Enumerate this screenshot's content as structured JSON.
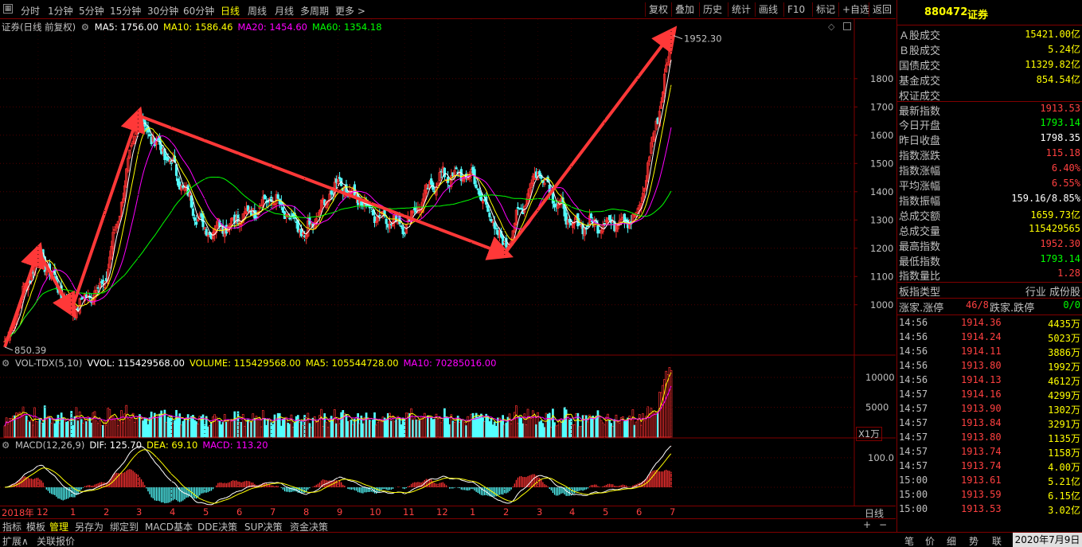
{
  "toolbar": {
    "periods": [
      "分时",
      "1分钟",
      "5分钟",
      "15分钟",
      "30分钟",
      "60分钟",
      "日线",
      "周线",
      "月线",
      "多周期",
      "更多 >"
    ],
    "active_period": "日线",
    "buttons": [
      "复权",
      "叠加",
      "历史",
      "统计",
      "画线",
      "F10",
      "标记",
      "+自选",
      "返回"
    ]
  },
  "main_chart": {
    "title": "证券(日线 前复权)",
    "ma_labels": [
      {
        "text": "MA5: 1756.00",
        "color": "#ffffff"
      },
      {
        "text": "MA10: 1586.46",
        "color": "#ffff00"
      },
      {
        "text": "MA20: 1454.60",
        "color": "#ff00ff"
      },
      {
        "text": "MA60: 1354.18",
        "color": "#00ff00"
      }
    ],
    "high_marker": "1952.30",
    "low_marker": "850.39",
    "y_ticks": [
      "1800",
      "1700",
      "1600",
      "1500",
      "1400",
      "1300",
      "1200",
      "1100",
      "1000"
    ]
  },
  "volume_chart": {
    "labels": [
      {
        "text": "VOL-TDX(5,10)",
        "color": "#c0c0c0"
      },
      {
        "text": "VVOL: 115429568.00",
        "color": "#ffffff"
      },
      {
        "text": "VOLUME: 115429568.00",
        "color": "#ffff00"
      },
      {
        "text": "MA5: 105544728.00",
        "color": "#ffff00"
      },
      {
        "text": "MA10: 70285016.00",
        "color": "#ff00ff"
      }
    ],
    "y_ticks": [
      "10000",
      "5000"
    ],
    "unit": "X1万"
  },
  "macd_chart": {
    "labels": [
      {
        "text": "MACD(12,26,9)",
        "color": "#c0c0c0"
      },
      {
        "text": "DIF: 125.70",
        "color": "#ffffff"
      },
      {
        "text": "DEA: 69.10",
        "color": "#ffff00"
      },
      {
        "text": "MACD: 113.20",
        "color": "#ff00ff"
      }
    ],
    "y_ticks": [
      "100.0"
    ]
  },
  "x_axis": {
    "labels": [
      "2018年",
      "12",
      "1",
      "2",
      "3",
      "4",
      "5",
      "6",
      "7",
      "8",
      "9",
      "10",
      "11",
      "12",
      "1",
      "2",
      "3",
      "4",
      "5",
      "6",
      "7"
    ],
    "period_label": "日线"
  },
  "bottom_tabs": [
    "指标",
    "模板",
    "管理",
    "另存为",
    "绑定到",
    "MACD基本",
    "DDE决策",
    "SUP决策",
    "资金决策"
  ],
  "active_bottom_tab": "管理",
  "status_bar": {
    "left": [
      "扩展∧",
      "关联报价"
    ],
    "right_tabs": [
      "笔",
      "价",
      "细",
      "势",
      "联"
    ],
    "date": "2020年7月9日"
  },
  "quote_panel": {
    "code": "880472",
    "name": "证券",
    "rows": [
      {
        "label": "Ａ股成交",
        "value": "15421.00亿",
        "color": "#ffff00"
      },
      {
        "label": "Ｂ股成交",
        "value": "5.24亿",
        "color": "#ffff00"
      },
      {
        "label": "国债成交",
        "value": "11329.82亿",
        "color": "#ffff00"
      },
      {
        "label": "基金成交",
        "value": "854.54亿",
        "color": "#ffff00"
      },
      {
        "label": "权证成交",
        "value": "",
        "color": "#ffff00"
      },
      {
        "label": "最新指数",
        "value": "1913.53",
        "color": "#ff4040"
      },
      {
        "label": "今日开盘",
        "value": "1793.14",
        "color": "#00ff00"
      },
      {
        "label": "昨日收盘",
        "value": "1798.35",
        "color": "#ffffff"
      },
      {
        "label": "指数涨跌",
        "value": "115.18",
        "color": "#ff4040"
      },
      {
        "label": "指数涨幅",
        "value": "6.40%",
        "color": "#ff4040"
      },
      {
        "label": "平均涨幅",
        "value": "6.55%",
        "color": "#ff4040"
      },
      {
        "label": "指数振幅",
        "value": "159.16/8.85%",
        "color": "#ffffff"
      },
      {
        "label": "总成交额",
        "value": "1659.73亿",
        "color": "#ffff00"
      },
      {
        "label": "总成交量",
        "value": "115429565",
        "color": "#ffff00"
      },
      {
        "label": "最高指数",
        "value": "1952.30",
        "color": "#ff4040"
      },
      {
        "label": "最低指数",
        "value": "1793.14",
        "color": "#00ff00"
      },
      {
        "label": "指数量比",
        "value": "1.28",
        "color": "#ff4040"
      }
    ],
    "type_row": {
      "label": "板指类型",
      "value": "行业 成份股"
    },
    "updown_row": {
      "up_label": "涨家.涨停",
      "up_value": "46/8",
      "down_label": "跌家.跌停",
      "down_value": "0/0"
    },
    "ticks": [
      {
        "time": "14:56",
        "price": "1914.36",
        "vol": "4435万"
      },
      {
        "time": "14:56",
        "price": "1914.24",
        "vol": "5023万"
      },
      {
        "time": "14:56",
        "price": "1914.11",
        "vol": "3886万"
      },
      {
        "time": "14:56",
        "price": "1913.80",
        "vol": "1992万"
      },
      {
        "time": "14:56",
        "price": "1914.13",
        "vol": "4612万"
      },
      {
        "time": "14:57",
        "price": "1914.16",
        "vol": "4299万"
      },
      {
        "time": "14:57",
        "price": "1913.90",
        "vol": "1302万"
      },
      {
        "time": "14:57",
        "price": "1913.84",
        "vol": "3291万"
      },
      {
        "time": "14:57",
        "price": "1913.80",
        "vol": "1135万"
      },
      {
        "time": "14:57",
        "price": "1913.74",
        "vol": "1158万"
      },
      {
        "time": "14:57",
        "price": "1913.74",
        "vol": "4.00万"
      },
      {
        "time": "15:00",
        "price": "1913.61",
        "vol": "5.21亿"
      },
      {
        "time": "15:00",
        "price": "1913.59",
        "vol": "6.15亿"
      },
      {
        "time": "15:00",
        "price": "1913.53",
        "vol": "3.02亿"
      }
    ]
  },
  "chart_data": {
    "type": "candlestick",
    "x_labels": [
      "2018年",
      "12",
      "1",
      "2",
      "3",
      "4",
      "5",
      "6",
      "7",
      "8",
      "9",
      "10",
      "11",
      "12",
      "1",
      "2",
      "3",
      "4",
      "5",
      "6",
      "7"
    ],
    "ylim": [
      850,
      1960
    ],
    "waypoints": [
      {
        "month": "2018-11",
        "close": 850
      },
      {
        "month": "2018-12",
        "close": 1190
      },
      {
        "month": "2019-01",
        "close": 980
      },
      {
        "month": "2019-02",
        "close": 1080
      },
      {
        "month": "2019-03",
        "close": 1660
      },
      {
        "month": "2019-04",
        "close": 1500
      },
      {
        "month": "2019-05",
        "close": 1260
      },
      {
        "month": "2019-06",
        "close": 1300
      },
      {
        "month": "2019-07",
        "close": 1380
      },
      {
        "month": "2019-08",
        "close": 1240
      },
      {
        "month": "2019-09",
        "close": 1440
      },
      {
        "month": "2019-10",
        "close": 1330
      },
      {
        "month": "2019-11",
        "close": 1280
      },
      {
        "month": "2019-12",
        "close": 1450
      },
      {
        "month": "2020-01",
        "close": 1460
      },
      {
        "month": "2020-02",
        "close": 1200
      },
      {
        "month": "2020-03",
        "close": 1480
      },
      {
        "month": "2020-04",
        "close": 1280
      },
      {
        "month": "2020-05",
        "close": 1290
      },
      {
        "month": "2020-06",
        "close": 1310
      },
      {
        "month": "2020-07",
        "close": 1913.53
      }
    ],
    "high": 1952.3,
    "low": 850.39,
    "annotation_arrows": [
      {
        "from_month": "2018-11",
        "from_value": 850,
        "to_month": "2018-12",
        "to_value": 1190
      },
      {
        "from_month": "2018-12",
        "from_value": 1190,
        "to_month": "2019-01",
        "to_value": 980
      },
      {
        "from_month": "2019-01",
        "from_value": 980,
        "to_month": "2019-03",
        "to_value": 1670
      },
      {
        "from_month": "2019-03",
        "from_value": 1670,
        "to_month": "2020-02",
        "to_value": 1180
      },
      {
        "from_month": "2020-02",
        "from_value": 1180,
        "to_month": "2020-07",
        "to_value": 1960
      }
    ]
  }
}
